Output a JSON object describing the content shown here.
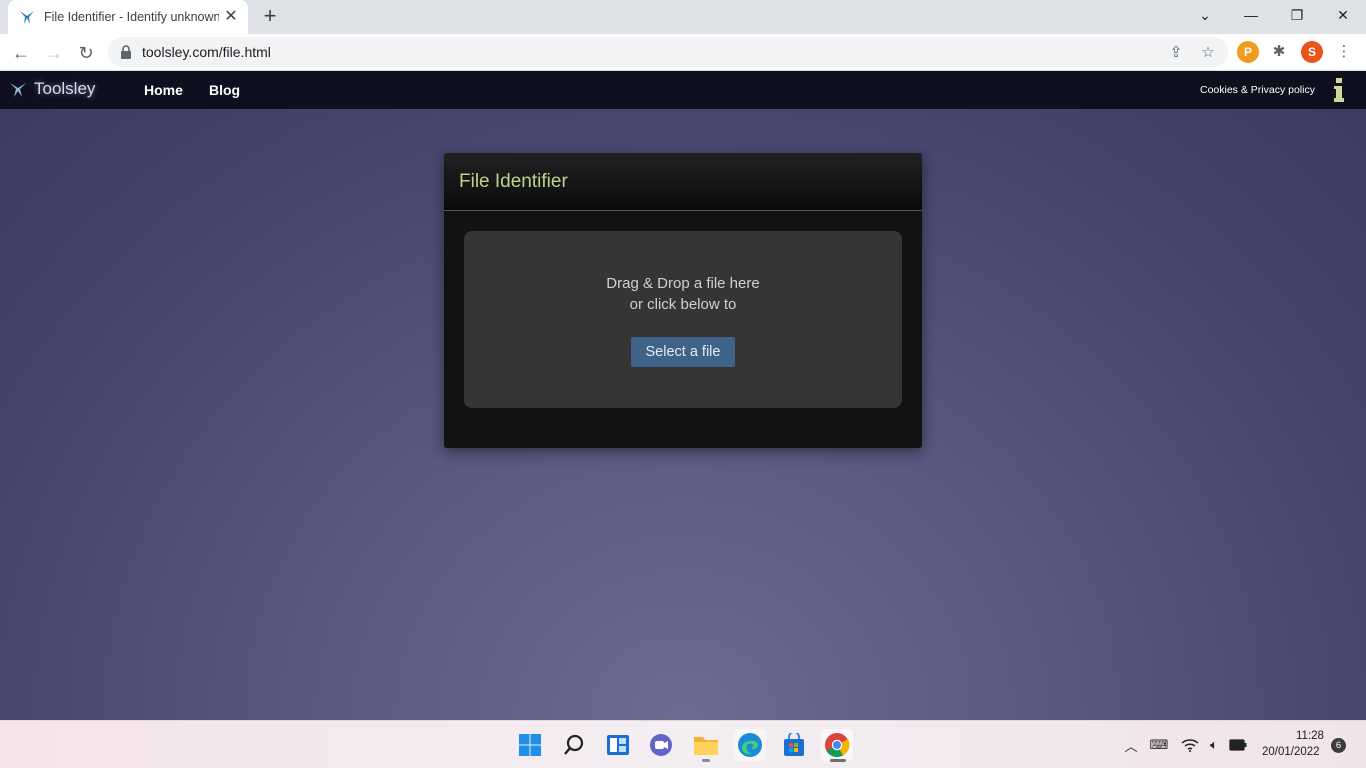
{
  "browser": {
    "tab_title": "File Identifier - Identify unknown",
    "url": "toolsley.com/file.html",
    "profile_initial": "S",
    "extension_initial": "P"
  },
  "site": {
    "brand": "Toolsley",
    "nav": [
      "Home",
      "Blog"
    ],
    "cookies_link": "Cookies & Privacy policy"
  },
  "tool": {
    "title": "File Identifier",
    "drop_line1": "Drag & Drop a file here",
    "drop_line2": "or click below to",
    "select_label": "Select a file"
  },
  "taskbar": {
    "time": "11:28",
    "date": "20/01/2022",
    "notifications": "6"
  },
  "colors": {
    "title_accent": "#bed38c",
    "button_blue": "#3f6289",
    "nav_bg": "#0e1020"
  }
}
